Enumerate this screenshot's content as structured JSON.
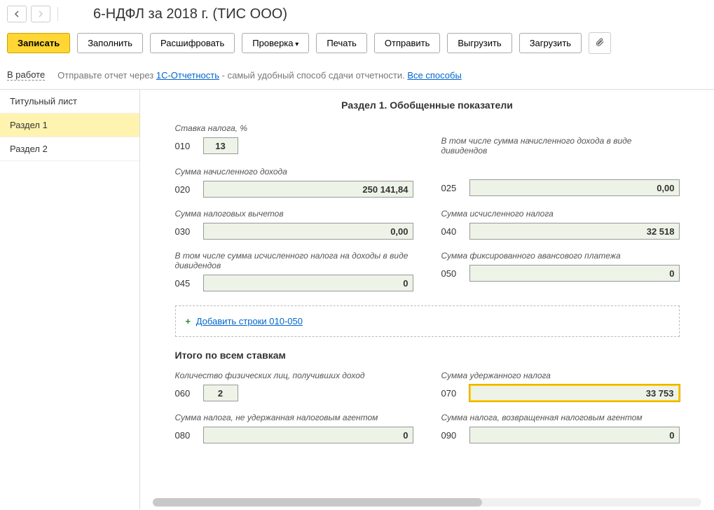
{
  "title": "6-НДФЛ за 2018 г. (ТИС ООО)",
  "toolbar": {
    "save": "Записать",
    "fill": "Заполнить",
    "decode": "Расшифровать",
    "check": "Проверка",
    "print": "Печать",
    "send": "Отправить",
    "export": "Выгрузить",
    "import": "Загрузить"
  },
  "status": {
    "badge": "В работе",
    "text1": "Отправьте отчет через ",
    "link1": "1С-Отчетность",
    "text2": " - самый удобный способ сдачи отчетности. ",
    "link2": "Все способы"
  },
  "sidebar": {
    "items": [
      {
        "label": "Титульный лист"
      },
      {
        "label": "Раздел 1"
      },
      {
        "label": "Раздел 2"
      }
    ]
  },
  "section": {
    "heading": "Раздел 1. Обобщенные показатели",
    "rate_label": "Ставка налога, %",
    "f010": {
      "code": "010",
      "value": "13"
    },
    "f020": {
      "code": "020",
      "label": "Сумма начисленного дохода",
      "value": "250 141,84"
    },
    "f025": {
      "code": "025",
      "label": "В том числе сумма начисленного дохода в виде дивидендов",
      "value": "0,00"
    },
    "f030": {
      "code": "030",
      "label": "Сумма налоговых вычетов",
      "value": "0,00"
    },
    "f040": {
      "code": "040",
      "label": "Сумма исчисленного налога",
      "value": "32 518"
    },
    "f045": {
      "code": "045",
      "label": "В том числе сумма исчисленного налога на доходы в виде дивидендов",
      "value": "0"
    },
    "f050": {
      "code": "050",
      "label": "Сумма фиксированного авансового платежа",
      "value": "0"
    },
    "add_link": "Добавить строки 010-050",
    "totals_heading": "Итого по всем ставкам",
    "f060": {
      "code": "060",
      "label": "Количество физических лиц, получивших доход",
      "value": "2"
    },
    "f070": {
      "code": "070",
      "label": "Сумма удержанного налога",
      "value": "33 753"
    },
    "f080": {
      "code": "080",
      "label": "Сумма налога, не удержанная налоговым агентом",
      "value": "0"
    },
    "f090": {
      "code": "090",
      "label": "Сумма налога, возвращенная налоговым агентом",
      "value": "0"
    }
  }
}
